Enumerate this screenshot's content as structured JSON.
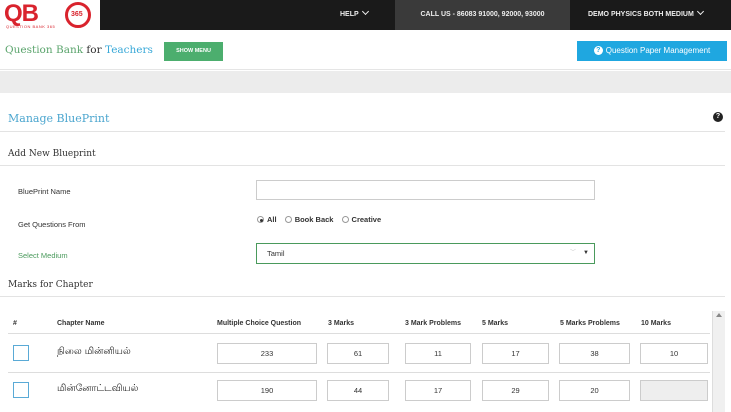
{
  "logo": {
    "letters": "QB",
    "badge": "365",
    "tagline": "QUESTION BANK 365"
  },
  "nav": {
    "help": "HELP",
    "call": "CALL US - 86083 91000, 92000, 93000",
    "user": "DEMO PHYSICS BOTH MEDIUM"
  },
  "header": {
    "brand_part1": "Question Bank",
    "brand_part2": "for",
    "brand_part3": "Teachers",
    "show_menu": "SHOW MENU",
    "qpm": "Question Paper Management"
  },
  "page": {
    "title": "Manage BluePrint",
    "add_section": "Add New Blueprint",
    "blueprint_name_label": "BluePrint Name",
    "blueprint_name_value": "",
    "get_questions_label": "Get Questions From",
    "options": [
      "All",
      "Book Back",
      "Creative"
    ],
    "selected_option": "All",
    "medium_label": "Select Medium",
    "medium_value": "Tamil",
    "marks_section": "Marks for Chapter"
  },
  "table": {
    "headers": [
      "#",
      "Chapter Name",
      "Multiple Choice Question",
      "3 Marks",
      "3 Mark Problems",
      "5 Marks",
      "5 Marks Problems",
      "10 Marks"
    ],
    "rows": [
      {
        "chapter": "நிலை மின்னியல்",
        "values": [
          "233",
          "61",
          "11",
          "17",
          "38",
          "10"
        ]
      },
      {
        "chapter": "மின்னோட்டவியல்",
        "values": [
          "190",
          "44",
          "17",
          "29",
          "20",
          ""
        ]
      }
    ]
  },
  "colors": {
    "topbar": "#1a1a1a",
    "brand_red": "#d9232d",
    "green": "#4cae6e",
    "blue": "#1fa7e0",
    "title_blue": "#4ca6cf"
  }
}
